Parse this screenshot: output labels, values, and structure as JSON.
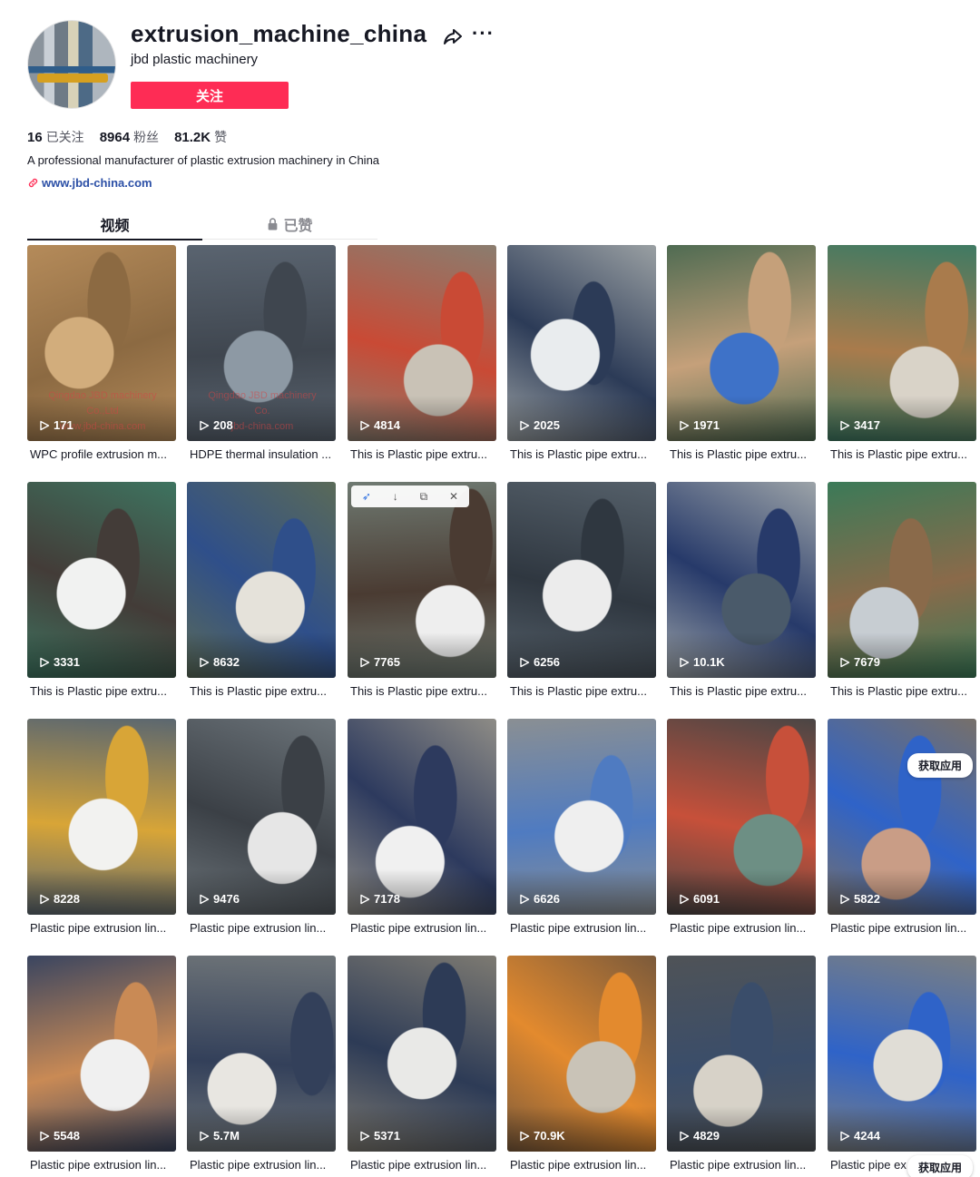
{
  "profile": {
    "username": "extrusion_machine_china",
    "nickname": "jbd plastic machinery",
    "follow_label": "关注",
    "stats": [
      {
        "num": "16",
        "label": "已关注"
      },
      {
        "num": "8964",
        "label": "粉丝"
      },
      {
        "num": "81.2K",
        "label": "赞"
      }
    ],
    "bio": "A professional manufacturer of plastic extrusion machinery in China",
    "link": "www.jbd-china.com"
  },
  "tabs": [
    {
      "label": "视频",
      "active": true
    },
    {
      "label": "已赞",
      "locked": true
    }
  ],
  "overlay": {
    "badge_label": "获取应用"
  },
  "watermarks": {
    "v1": [
      "Qingdao JBD machinery",
      "Co.,Ltd",
      "www.jbd-china.com"
    ],
    "v2": [
      "Qingdao JBD machinery",
      "Co.",
      "jbd-china.com"
    ]
  },
  "videos": [
    {
      "views": "171",
      "caption": "WPC profile extrusion m...",
      "palette": [
        "#b58b5a",
        "#8c6a42",
        "#d2ad7c"
      ]
    },
    {
      "views": "208",
      "caption": "HDPE thermal insulation ...",
      "palette": [
        "#5a6470",
        "#3f464f",
        "#8d99a4"
      ]
    },
    {
      "views": "4814",
      "caption": "This is Plastic pipe extru...",
      "palette": [
        "#8a7d6f",
        "#c94a35",
        "#c9c2b6"
      ]
    },
    {
      "views": "2025",
      "caption": "This is Plastic pipe extru...",
      "palette": [
        "#9aa0a3",
        "#2c3b57",
        "#e9ecee"
      ]
    },
    {
      "views": "1971",
      "caption": "This is Plastic pipe extru...",
      "palette": [
        "#4f6b52",
        "#c5a07a",
        "#3e72c8"
      ]
    },
    {
      "views": "3417",
      "caption": "This is Plastic pipe extru...",
      "palette": [
        "#3f7a63",
        "#a97b4c",
        "#d9d3c8"
      ]
    },
    {
      "views": "3331",
      "caption": "This is Plastic pipe extru...",
      "palette": [
        "#3e7460",
        "#433c38",
        "#f1f2f1"
      ]
    },
    {
      "views": "8632",
      "caption": "This is Plastic pipe extru...",
      "palette": [
        "#5a6a58",
        "#2f4f8a",
        "#e5e2da"
      ]
    },
    {
      "views": "7765",
      "caption": "This is Plastic pipe extru...",
      "palette": [
        "#6f7a72",
        "#4a3b32",
        "#eeeeee"
      ]
    },
    {
      "views": "6256",
      "caption": "This is Plastic pipe extru...",
      "palette": [
        "#55606a",
        "#2f3740",
        "#ececec"
      ]
    },
    {
      "views": "10.1K",
      "caption": "This is Plastic pipe extru...",
      "palette": [
        "#9ca3a8",
        "#273a6a",
        "#4a5a6a"
      ]
    },
    {
      "views": "7679",
      "caption": "This is Plastic pipe extru...",
      "palette": [
        "#3b7a58",
        "#8a6a4a",
        "#c7cdd2"
      ]
    },
    {
      "views": "8228",
      "caption": "Plastic pipe extrusion lin...",
      "palette": [
        "#5b6770",
        "#d8a537",
        "#f2f2f0"
      ]
    },
    {
      "views": "9476",
      "caption": "Plastic pipe extrusion lin...",
      "palette": [
        "#6c747a",
        "#3b4046",
        "#e6e6e6"
      ]
    },
    {
      "views": "7178",
      "caption": "Plastic pipe extrusion lin...",
      "palette": [
        "#8e8c86",
        "#2d3a5e",
        "#f0f0f0"
      ]
    },
    {
      "views": "6626",
      "caption": "Plastic pipe extrusion lin...",
      "palette": [
        "#8a8f93",
        "#4f7bc1",
        "#efefef"
      ]
    },
    {
      "views": "6091",
      "caption": "Plastic pipe extrusion lin...",
      "palette": [
        "#4a4645",
        "#c7503a",
        "#6d8f84"
      ]
    },
    {
      "views": "5822",
      "caption": "Plastic pipe extrusion lin...",
      "palette": [
        "#77706a",
        "#2f63c8",
        "#c99d86"
      ]
    },
    {
      "views": "5548",
      "caption": "Plastic pipe extrusion lin...",
      "palette": [
        "#3a4560",
        "#c98a55",
        "#f0f0f0"
      ]
    },
    {
      "views": "5.7M",
      "caption": "Plastic pipe extrusion lin...",
      "palette": [
        "#6e7478",
        "#33405a",
        "#e8e6e1"
      ]
    },
    {
      "views": "5371",
      "caption": "Plastic pipe extrusion lin...",
      "palette": [
        "#7d7a72",
        "#2d3b56",
        "#e9e9e7"
      ]
    },
    {
      "views": "70.9K",
      "caption": "Plastic pipe extrusion lin...",
      "palette": [
        "#7b5a3b",
        "#e38a2e",
        "#c9c3b7"
      ]
    },
    {
      "views": "4829",
      "caption": "Plastic pipe extrusion lin...",
      "palette": [
        "#4f5357",
        "#3a4d6a",
        "#d7d2c8"
      ]
    },
    {
      "views": "4244",
      "caption": "Plastic pipe ex",
      "palette": [
        "#7b7f82",
        "#2f63c8",
        "#e0ddd6"
      ]
    }
  ]
}
